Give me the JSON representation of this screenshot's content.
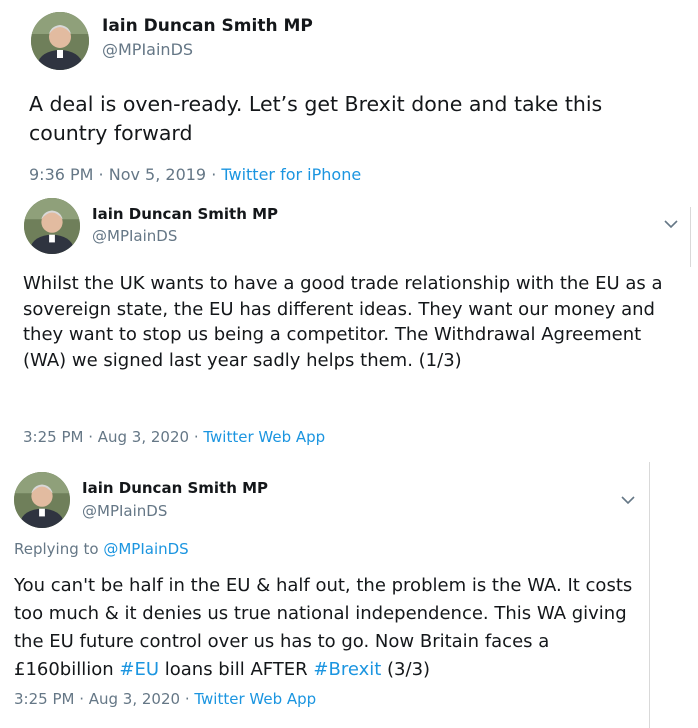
{
  "tweets": [
    {
      "author_name": "Iain Duncan Smith MP",
      "author_handle": "@MPIainDS",
      "text": "A deal is oven-ready. Let’s get Brexit done and take this country forward",
      "time": "9:36 PM · Nov 5, 2019 · ",
      "source": "Twitter for iPhone"
    },
    {
      "author_name": "Iain Duncan Smith MP",
      "author_handle": "@MPIainDS",
      "text": "Whilst the UK wants to have a good trade relationship with the EU as a sovereign state, the EU has different ideas. They want our money and they want to stop us being a competitor. The Withdrawal Agreement (WA) we signed last year sadly helps them. (1/3)",
      "time": "3:25 PM · Aug 3, 2020 · ",
      "source": "Twitter Web App"
    },
    {
      "author_name": "Iain Duncan Smith MP",
      "author_handle": "@MPIainDS",
      "replying_label": "Replying to ",
      "replying_handle": "@MPIainDS",
      "text_before": "You can't be half in the EU & half out, the problem is the WA. It costs too much & it denies us true national independence. This WA giving the EU future control over us has to go. Now Britain faces a £160billion ",
      "hashtag_eu": "#EU",
      "text_middle": " loans bill AFTER ",
      "hashtag_brexit": "#Brexit",
      "text_after": " (3/3)",
      "time": "3:25 PM · Aug 3, 2020 · ",
      "source": "Twitter Web App"
    }
  ],
  "icons": {
    "more": "chevron-down-icon"
  },
  "colors": {
    "link": "#1b95e0",
    "secondary": "#657786",
    "text": "#14171a"
  }
}
